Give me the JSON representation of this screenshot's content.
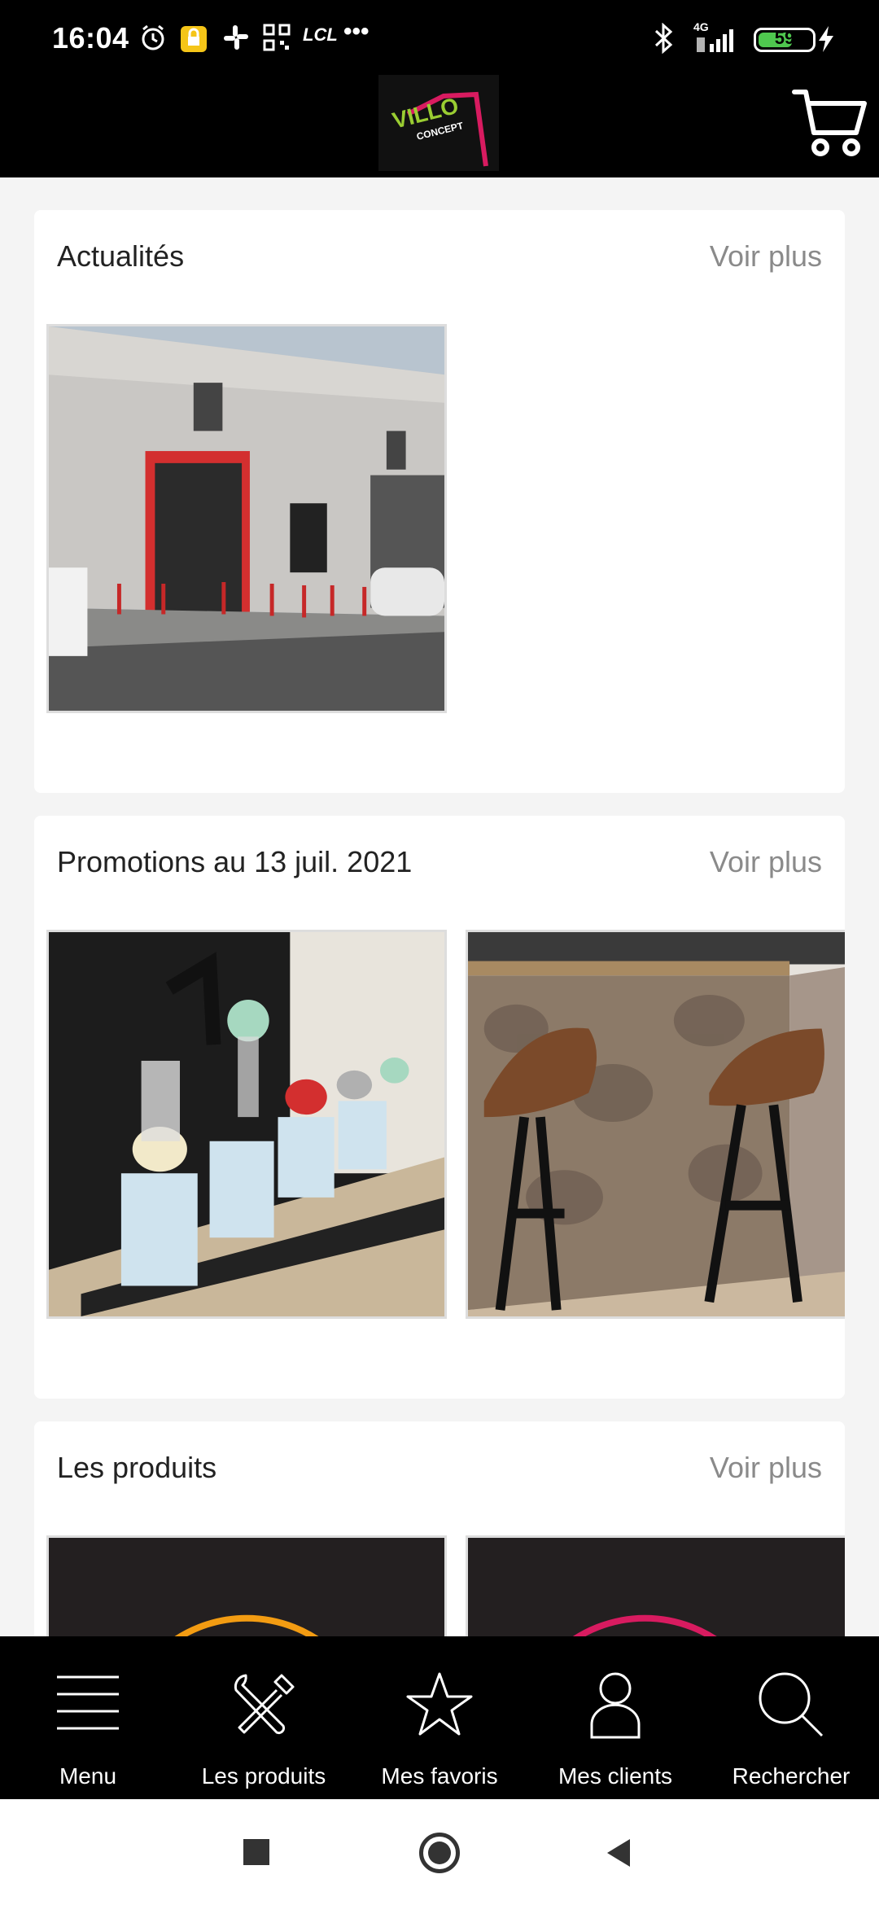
{
  "status_bar": {
    "time": "16:04",
    "network": "4G",
    "battery": "59",
    "icons": [
      "alarm-icon",
      "sim-lock-icon",
      "slack-icon",
      "qr-icon",
      "lcl-icon",
      "more-icon",
      "bluetooth-icon",
      "signal-icon",
      "battery-icon",
      "charging-icon"
    ],
    "lcl_text": "LCL",
    "more_text": "•••"
  },
  "header": {
    "logo_text": "VILLO",
    "logo_subtext": "CONCEPT"
  },
  "sections": [
    {
      "title": "Actualités",
      "more": "Voir plus"
    },
    {
      "title": "Promotions au 13 juil. 2021",
      "more": "Voir plus"
    },
    {
      "title": "Les produits",
      "more": "Voir plus"
    }
  ],
  "bottom_nav": {
    "items": [
      {
        "label": "Menu",
        "icon": "menu-icon"
      },
      {
        "label": "Les produits",
        "icon": "tools-icon"
      },
      {
        "label": "Mes favoris",
        "icon": "star-icon"
      },
      {
        "label": "Mes clients",
        "icon": "person-icon"
      },
      {
        "label": "Rechercher",
        "icon": "search-icon"
      }
    ]
  },
  "colors": {
    "topbar": "#000000",
    "accent_pink": "#d81b60",
    "accent_orange": "#f39c12",
    "logo_green": "#9acd32"
  }
}
